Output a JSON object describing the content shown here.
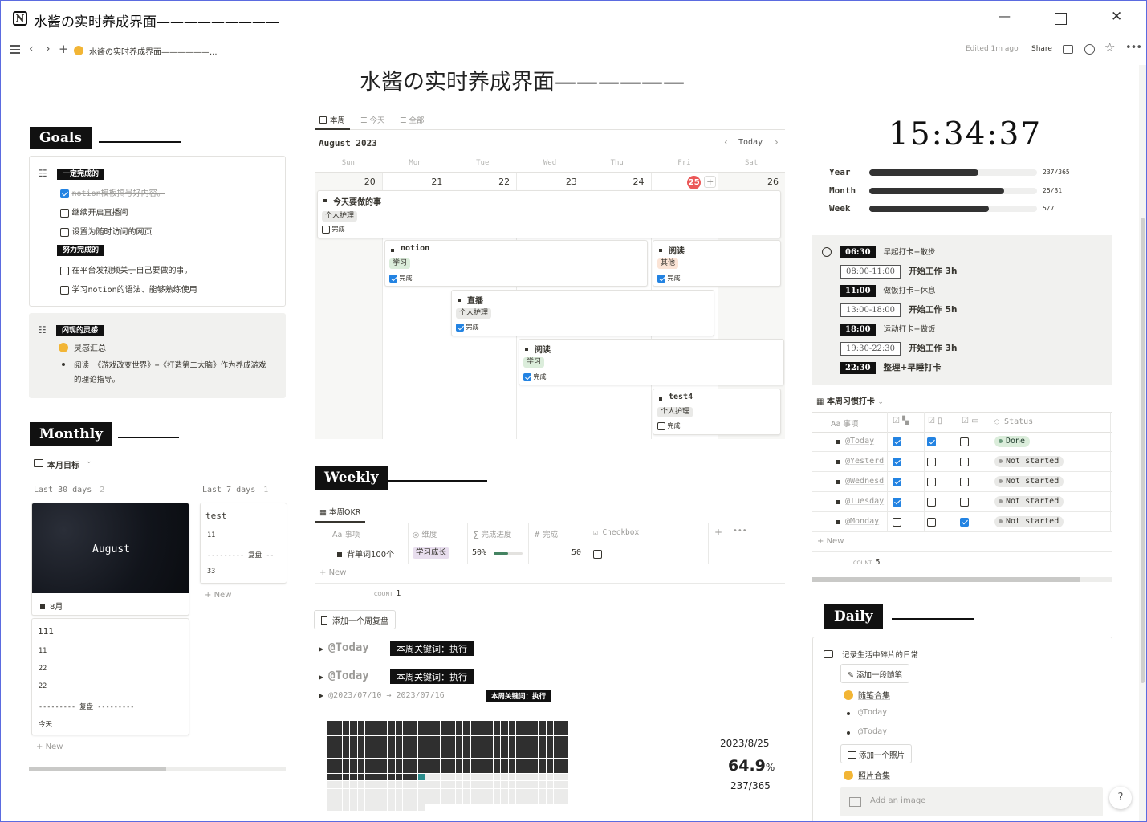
{
  "window": {
    "title": "水酱の实时养成界面—————————",
    "minimize": "—",
    "maximize": "☐",
    "close": "✕"
  },
  "topbar": {
    "breadcrumb": "水酱の实时养成界面——————...",
    "edited": "Edited 1m ago",
    "share": "Share"
  },
  "page": {
    "title": "水酱の实时养成界面——————"
  },
  "goals": {
    "header": "Goals",
    "must": {
      "label": "一定完成的",
      "items": [
        {
          "text": "notion模板搞号好内容。",
          "done": true
        },
        {
          "text": "继续开启直播间",
          "done": false
        },
        {
          "text": "设置为随时访问的网页",
          "done": false
        }
      ]
    },
    "effort": {
      "label": "努力完成的",
      "items": [
        {
          "text": "在平台发视频关于自己要做的事。",
          "done": false
        },
        {
          "text": "学习notion的语法、能够熟练使用",
          "done": false
        }
      ]
    },
    "inspiration": {
      "label": "闪现的灵感",
      "link": "灵感汇总",
      "bullet": "阅读 《游戏改变世界》+《打造第二大脑》作为养成游戏的理论指导。"
    }
  },
  "monthly": {
    "header": "Monthly",
    "view": "本月目标",
    "col1": {
      "label": "Last 30 days",
      "count": "2",
      "card1_image": "August",
      "card1_title": "8月",
      "card2": {
        "title": "111",
        "lines": [
          "11",
          "22",
          "22",
          "--------- 复盘 ---------",
          "今天"
        ]
      },
      "new": "New"
    },
    "col2": {
      "label": "Last 7 days",
      "count": "1",
      "card": {
        "title": "test",
        "lines": [
          "11",
          "--------- 复盘 --",
          "33"
        ]
      },
      "new": "New"
    }
  },
  "calendar": {
    "tabs": [
      "本周",
      "今天",
      "全部"
    ],
    "month": "August 2023",
    "today_btn": "Today",
    "weekdays": [
      "Sun",
      "Mon",
      "Tue",
      "Wed",
      "Thu",
      "Fri",
      "Sat"
    ],
    "dates": [
      "20",
      "21",
      "22",
      "23",
      "24",
      "25",
      "26"
    ],
    "events": [
      {
        "title": "今天要做的事",
        "tag": "个人护理",
        "check": "完成",
        "done": false
      },
      {
        "title": "notion",
        "tag": "学习",
        "check": "完成",
        "done": true
      },
      {
        "title": "阅读",
        "tag": "其他",
        "check": "完成",
        "done": true
      },
      {
        "title": "直播",
        "tag": "个人护理",
        "check": "完成",
        "done": true
      },
      {
        "title": "阅读",
        "tag": "学习",
        "check": "完成",
        "done": true
      },
      {
        "title": "test4",
        "tag": "个人护理",
        "check": "完成",
        "done": false
      }
    ]
  },
  "weekly": {
    "header": "Weekly",
    "view": "本周OKR",
    "columns": [
      "事项",
      "维度",
      "完成进度",
      "完成",
      "Checkbox"
    ],
    "row": {
      "item": "背单词100个",
      "dim": "学习成长",
      "progress": "50%",
      "progress_value": 0.5,
      "done": "50"
    },
    "new": "New",
    "count_label": "COUNT",
    "count": "1",
    "add_btn": "添加一个周复盘",
    "toggles": [
      {
        "title": "@Today",
        "badge": "本周关键词：执行"
      },
      {
        "title": "@Today",
        "badge": "本周关键词：执行"
      },
      {
        "title": "@2023/07/10 → 2023/07/16",
        "badge": "本周关键词：执行"
      }
    ],
    "year_date": "2023/8/25",
    "year_pct": "64.9",
    "pct_sign": "%",
    "year_days": "237/365"
  },
  "clock": {
    "time": "15:34:37",
    "rows": [
      {
        "label": "Year",
        "value": "237/365",
        "fraction": 0.649
      },
      {
        "label": "Month",
        "value": "25/31",
        "fraction": 0.806
      },
      {
        "label": "Week",
        "value": "5/7",
        "fraction": 0.714
      }
    ]
  },
  "schedule": [
    {
      "time": "06:30",
      "style": "dark",
      "text": "早起打卡+散步",
      "bold": false
    },
    {
      "time": "08:00-11:00",
      "style": "box",
      "text": "开始工作 3h",
      "bold": true
    },
    {
      "time": "11:00",
      "style": "dark",
      "text": "做饭打卡+休息",
      "bold": false
    },
    {
      "time": "13:00-18:00",
      "style": "box",
      "text": "开始工作 5h",
      "bold": true
    },
    {
      "time": "18:00",
      "style": "dark",
      "text": "运动打卡+做饭",
      "bold": false
    },
    {
      "time": "19:30-22:30",
      "style": "box",
      "text": "开始工作 3h",
      "bold": true
    },
    {
      "time": "22:30",
      "style": "dark",
      "text": "整理+早睡打卡",
      "bold": true
    }
  ],
  "habits": {
    "view": "本周习惯打卡",
    "col_item": "事项",
    "col_status": "Status",
    "rows": [
      {
        "name": "@Today",
        "c1": true,
        "c2": true,
        "c3": false,
        "status": "Done"
      },
      {
        "name": "@Yesterd",
        "c1": true,
        "c2": false,
        "c3": false,
        "status": "Not started"
      },
      {
        "name": "@Wednesd",
        "c1": true,
        "c2": false,
        "c3": false,
        "status": "Not started"
      },
      {
        "name": "@Tuesday",
        "c1": true,
        "c2": false,
        "c3": false,
        "status": "Not started"
      },
      {
        "name": "@Monday",
        "c1": false,
        "c2": false,
        "c3": true,
        "status": "Not started"
      }
    ],
    "new": "New",
    "count_label": "COUNT",
    "count": "5"
  },
  "daily": {
    "header": "Daily",
    "caption": "记录生活中碎片的日常",
    "add_note": "添加一段随笔",
    "notes_link": "随笔合集",
    "notes": [
      "@Today",
      "@Today"
    ],
    "add_photo": "添加一个照片",
    "photos_link": "照片合集",
    "add_image": "Add an image"
  },
  "help": "?",
  "colors": {
    "accent": "#2383e2",
    "dark": "#111111",
    "today_red": "#eb5757",
    "teal": "#2a8c8c"
  }
}
